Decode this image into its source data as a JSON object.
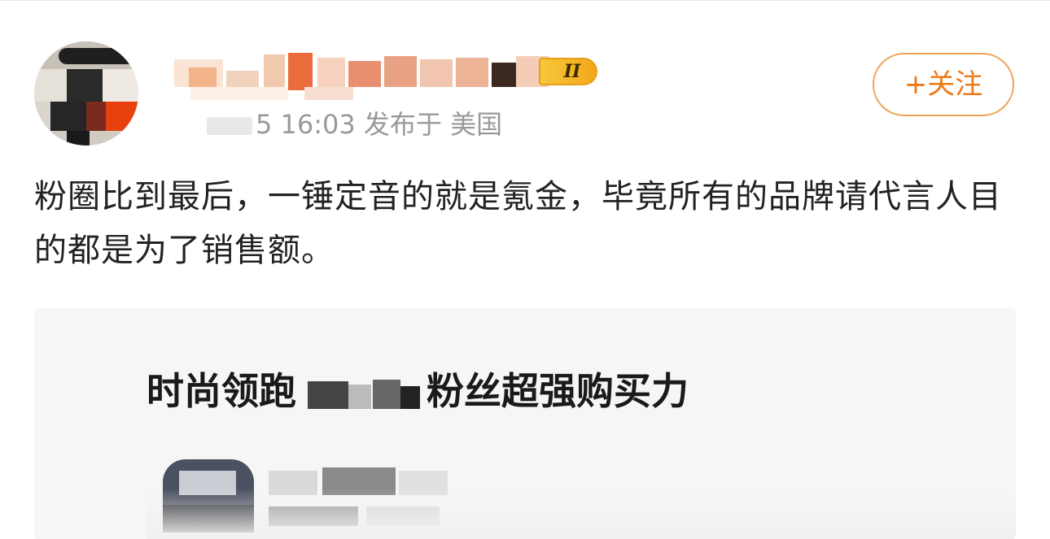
{
  "post": {
    "level_badge": "II",
    "time_fragment": "5 16:03",
    "location_text": "发布于 美国",
    "follow_label": "+关注",
    "content_text": "粉圈比到最后，一锤定音的就是氪金，毕竟所有的品牌请代言人目的都是为了销售额。"
  },
  "card": {
    "title_prefix": "时尚领跑",
    "title_suffix": "粉丝超强购买力"
  },
  "colors": {
    "accent": "#ec7a17",
    "follow_border": "#f0a35a",
    "badge": "#f2a71a",
    "meta_gray": "#999999",
    "card_bg": "#f6f6f6"
  },
  "icons": {
    "level": "level-badge-icon",
    "follow": "plus-icon"
  }
}
